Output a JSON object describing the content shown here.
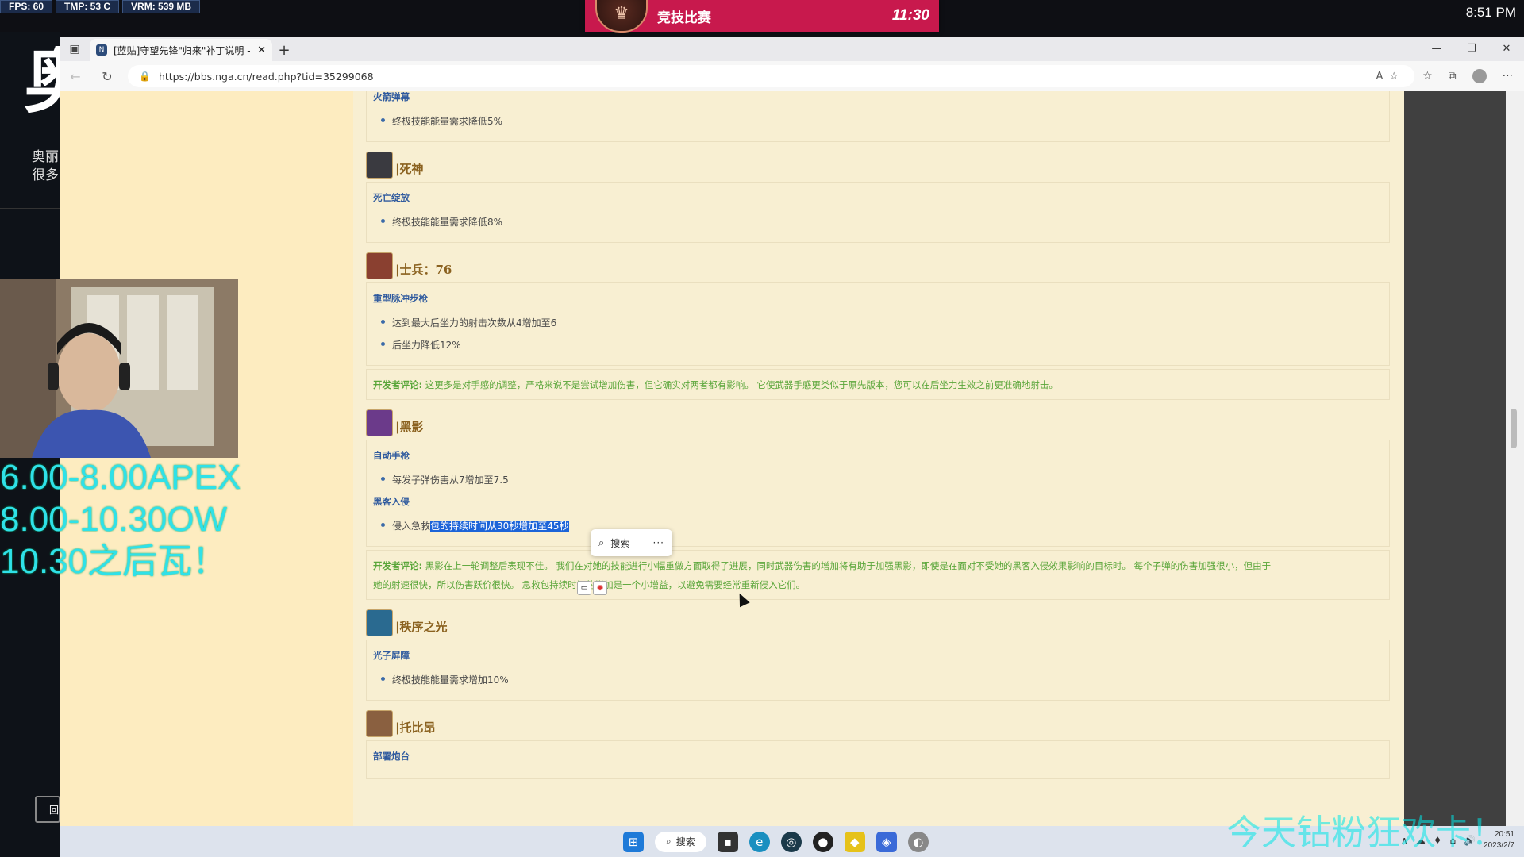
{
  "overlay": {
    "fps": "FPS:  60",
    "tmp": "TMP:  53 C",
    "vram": "VRM:  539 MB",
    "competitive_label": "竞技比赛",
    "competitive_time": "11:30",
    "clock": "8:51 PM",
    "left_text_1": "奥丽",
    "left_text_2": "很多",
    "left_button": "回",
    "schedule": [
      "6.00-8.00APEX",
      "8.00-10.30OW",
      "10.30之后瓦！"
    ],
    "watermark": "今天钻粉狂欢卡！"
  },
  "browser": {
    "tab_title": "[蓝贴]守望先锋\"归来\"补丁说明 -",
    "url": "https://bbs.nga.cn/read.php?tid=35299068",
    "window_controls": [
      "minimize",
      "maximize",
      "close"
    ]
  },
  "article": {
    "top_partial_skill": "火箭弹幕",
    "top_partial_bullet": "终极技能能量需求降低5%",
    "heroes": [
      {
        "name": "|死神",
        "color": "#3a3a40",
        "skills": [
          {
            "name": "死亡绽放",
            "bullets": [
              "终极技能能量需求降低8%"
            ]
          }
        ]
      },
      {
        "name": "|士兵：76",
        "color": "#8a4030",
        "skills": [
          {
            "name": "重型脉冲步枪",
            "bullets": [
              "达到最大后坐力的射击次数从4增加至6",
              "后坐力降低12%"
            ]
          }
        ],
        "dev_label": "开发者评论:",
        "dev_text": "这更多是对手感的调整，严格来说不是尝试增加伤害，但它确实对两者都有影响。 它使武器手感更类似于原先版本，您可以在后坐力生效之前更准确地射击。"
      },
      {
        "name": "|黑影",
        "color": "#6b3a8a",
        "skills": [
          {
            "name": "自动手枪",
            "bullets": [
              "每发子弹伤害从7增加至7.5"
            ]
          },
          {
            "name": "黑客入侵",
            "bullet_plain": "侵入急救",
            "bullet_highlight": "包的持续时间从30秒增加至45秒"
          }
        ],
        "dev_label": "开发者评论:",
        "dev_text_1": "黑影在上一轮调整后表现不佳。 我们在对她的技能进行小幅重做方面取得了进展，同时武器伤害的增加将有助于加强黑影，即使是在面对不受她的黑客入侵效果影响的目标时。 每个子弹的伤害加强很小，但由于",
        "dev_text_2": "她的射速很快，所以伤害跃价很快。 急救包持续时间的增加是一个小增益，以避免需要经常重新侵入它们。"
      },
      {
        "name": "|秩序之光",
        "color": "#2a6a90",
        "skills": [
          {
            "name": "光子屏障",
            "bullets": [
              "终极技能能量需求增加10%"
            ]
          }
        ]
      },
      {
        "name": "|托比昂",
        "color": "#8a6040",
        "skills": [
          {
            "name": "部署炮台",
            "bullets": []
          }
        ]
      }
    ]
  },
  "popup": {
    "search_label": "搜索",
    "more": "···"
  },
  "taskbar": {
    "search_label": "搜索",
    "date": "2023/2/7",
    "time": "20:51"
  }
}
